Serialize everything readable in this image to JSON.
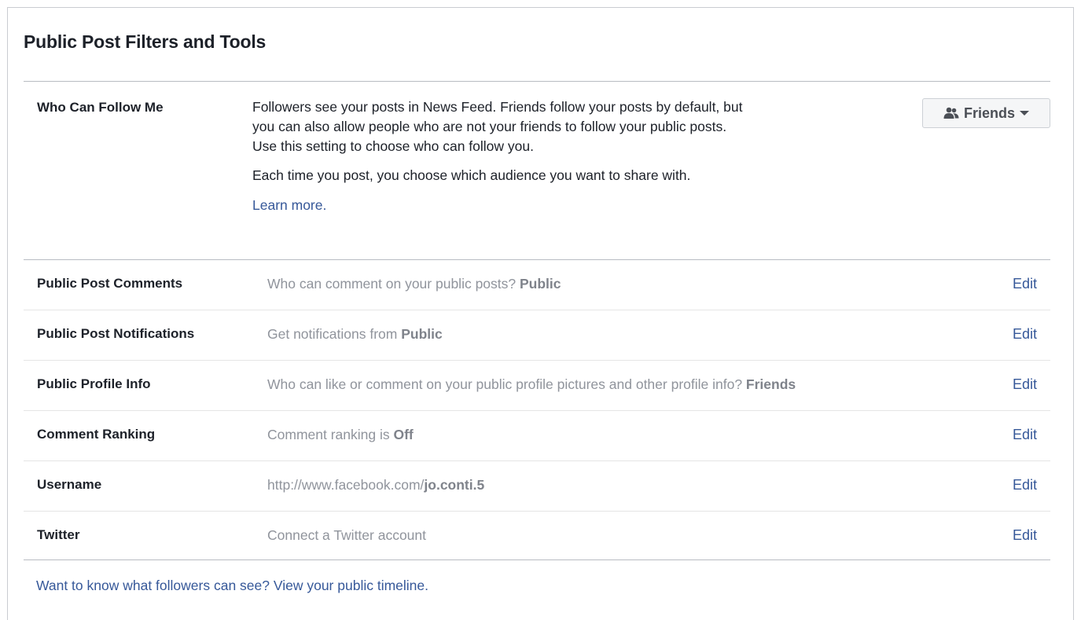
{
  "panel": {
    "title": "Public Post Filters and Tools"
  },
  "follow": {
    "label": "Who Can Follow Me",
    "description": "Followers see your posts in News Feed. Friends follow your posts by default, but you can also allow people who are not your friends to follow your public posts. Use this setting to choose who can follow you.",
    "description_line1": "Followers see your posts in News Feed. Friends follow your posts by default, but",
    "description_line2": "you can also allow people who are not your friends to follow your public posts.",
    "description_line3": "Use this setting to choose who can follow you.",
    "audience_note": "Each time you post, you choose which audience you want to share with.",
    "learn_more": "Learn more.",
    "audience_button": {
      "label": "Friends",
      "icon": "friends-icon",
      "caret": "caret-down-icon"
    }
  },
  "settings": [
    {
      "label": "Public Post Comments",
      "value_prefix": "Who can comment on your public posts? ",
      "value_bold": "Public",
      "action": "Edit"
    },
    {
      "label": "Public Post Notifications",
      "value_prefix": "Get notifications from ",
      "value_bold": "Public",
      "action": "Edit"
    },
    {
      "label": "Public Profile Info",
      "value_prefix": "Who can like or comment on your public profile pictures and other profile info? ",
      "value_bold": "Friends",
      "action": "Edit"
    },
    {
      "label": "Comment Ranking",
      "value_prefix": "Comment ranking is ",
      "value_bold": "Off",
      "action": "Edit"
    },
    {
      "label": "Username",
      "value_prefix": "http://www.facebook.com/",
      "value_bold": "jo.conti.5",
      "action": "Edit"
    },
    {
      "label": "Twitter",
      "value_prefix": "Connect a Twitter account",
      "value_bold": "",
      "action": "Edit"
    }
  ],
  "footer": {
    "link": "Want to know what followers can see? View your public timeline."
  },
  "colors": {
    "link": "#365899",
    "text": "#1d2129",
    "muted": "#90949c",
    "border": "#b8bcc2"
  }
}
